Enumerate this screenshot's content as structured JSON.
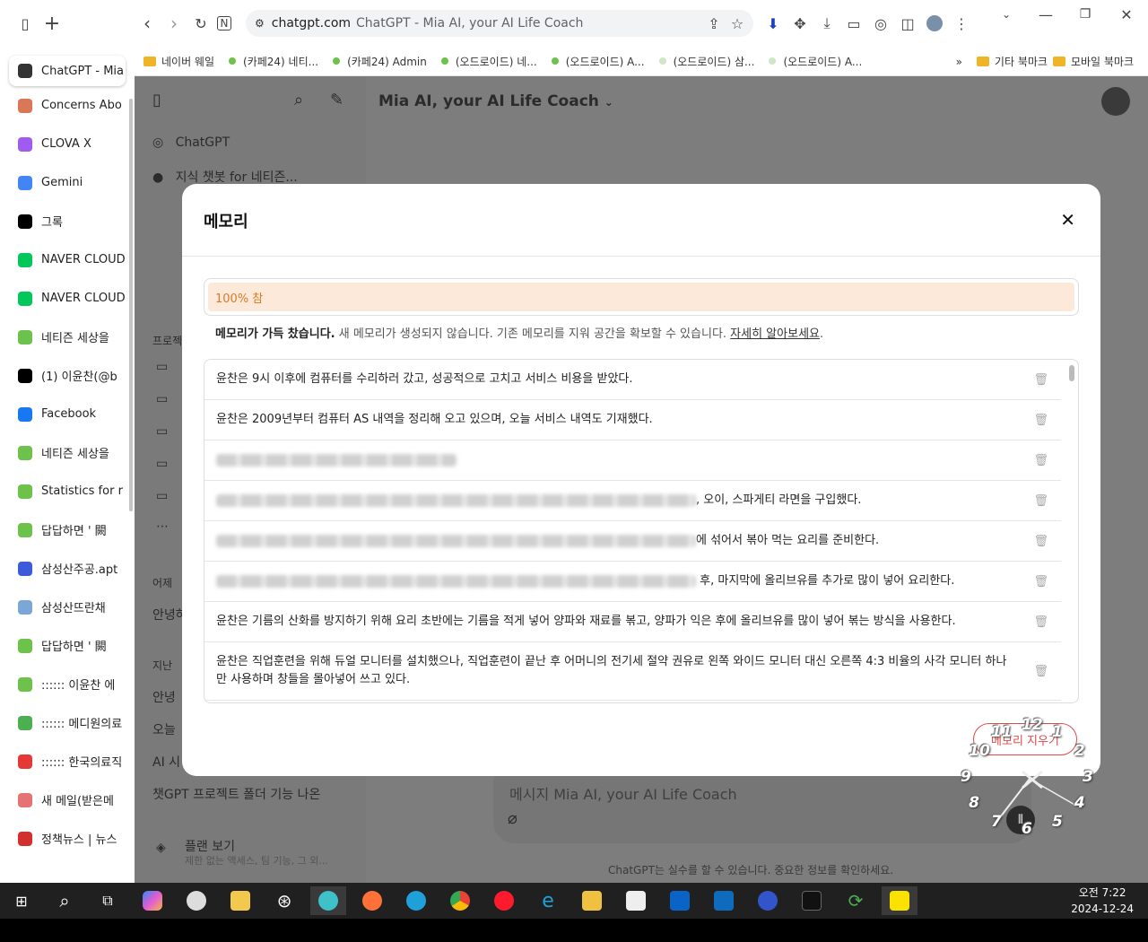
{
  "browser": {
    "url_domain": "chatgpt.com",
    "page_title": "ChatGPT - Mia AI, your AI Life Coach",
    "bookmarks": [
      "네이버 웨일",
      "(카페24) 네티...",
      "(카페24) Admin",
      "(오드로이드) 네...",
      "(오드로이드) A...",
      "(오드로이드) 삼...",
      "(오드로이드) A..."
    ],
    "bookmarks_overflow": "»",
    "bookmark_folders": [
      "기타 북마크",
      "모바일 북마크"
    ]
  },
  "tabs": [
    {
      "label": "ChatGPT - Mia",
      "icon": "chatgpt-icon",
      "color": "#333333"
    },
    {
      "label": "Concerns Abo",
      "icon": "claude-icon",
      "color": "#d97757"
    },
    {
      "label": "CLOVA X",
      "icon": "clova-icon",
      "color": "#a05cf0"
    },
    {
      "label": "Gemini",
      "icon": "gemini-icon",
      "color": "#4285f4"
    },
    {
      "label": "그록",
      "icon": "x-icon",
      "color": "#000000"
    },
    {
      "label": "NAVER CLOUD",
      "icon": "naver-cloud-icon",
      "color": "#03c75a"
    },
    {
      "label": "NAVER CLOUD",
      "icon": "naver-cloud-icon",
      "color": "#03c75a"
    },
    {
      "label": "네티즌 세상을",
      "icon": "y-icon",
      "color": "#6cc24a"
    },
    {
      "label": "(1) 이윤찬(@b",
      "icon": "x-icon",
      "color": "#000000"
    },
    {
      "label": "Facebook",
      "icon": "facebook-icon",
      "color": "#1877f2"
    },
    {
      "label": "네티즌 세상을",
      "icon": "y-icon",
      "color": "#6cc24a"
    },
    {
      "label": "Statistics for r",
      "icon": "y-icon",
      "color": "#6cc24a"
    },
    {
      "label": "답답하면 ' 闕",
      "icon": "y-icon",
      "color": "#6cc24a"
    },
    {
      "label": "삼성산주공.apt",
      "icon": "app-icon",
      "color": "#3b5bdb"
    },
    {
      "label": "삼성산뜨란채",
      "icon": "app-icon",
      "color": "#7aa6d8"
    },
    {
      "label": "답답하면 ' 闕",
      "icon": "y-icon",
      "color": "#6cc24a"
    },
    {
      "label": ":::::: 이윤찬 에",
      "icon": "y-icon",
      "color": "#6cc24a"
    },
    {
      "label": ":::::: 메디원의료",
      "icon": "medi-icon",
      "color": "#4caf50"
    },
    {
      "label": ":::::: 한국의료직",
      "icon": "medi-icon",
      "color": "#e53935"
    },
    {
      "label": "새 메일(받은메",
      "icon": "mail-icon",
      "color": "#e57373"
    },
    {
      "label": "정책뉴스 | 뉴스",
      "icon": "news-icon",
      "color": "#d32f2f"
    }
  ],
  "app": {
    "title": "Mia AI, your AI Life Coach",
    "sidebar": {
      "top": [
        {
          "label": "ChatGPT",
          "icon": "chatgpt-icon"
        },
        {
          "label": "지식 챗봇 for 네티즌...",
          "icon": "gpt-avatar-icon"
        }
      ],
      "sections": [
        "프로젝",
        "어제",
        "안녕하",
        "지난",
        "안녕",
        "오늘",
        "AI 시"
      ],
      "recent": "챗GPT 프로젝트 폴더 기능 나온",
      "upgrade_title": "플랜 보기",
      "upgrade_sub": "제한 없는 액세스, 팀 기능, 그 외..."
    },
    "composer_placeholder": "메시지 Mia AI, your AI Life Coach",
    "disclaimer": "ChatGPT는 실수를 할 수 있습니다. 중요한 정보를 확인하세요."
  },
  "modal": {
    "title": "메모리",
    "progress_label": "100% 참",
    "progress_value": 1.0,
    "notice_bold": "메모리가 가득 찼습니다.",
    "notice_text": " 새 메모리가 생성되지 않습니다. 기존 메모리를 지워 공간을 확보할 수 있습니다. ",
    "notice_link": "자세히 알아보세요",
    "notice_end": ".",
    "items": [
      "윤찬은 9시 이후에 컴퓨터를 수리하러 갔고, 성공적으로 고치고 서비스 비용을 받았다.",
      "윤찬은 2009년부터 컴퓨터 AS 내역을 정리해 오고 있으며, 오늘 서비스 내역도 기재했다.",
      "",
      ", 오이, 스파게티 라면을 구입했다.",
      "에 섞어서 볶아 먹는 요리를 준비한다.",
      " 후, 마지막에 올리브유를 추가로 많이 넣어 요리한다.",
      "윤찬은 기름의 산화를 방지하기 위해 요리 초반에는 기름을 적게 넣어 양파와 재료를 볶고, 양파가 익은 후에 올리브유를 많이 넣어 볶는 방식을 사용한다.",
      "윤찬은 직업훈련을 위해 듀얼 모니터를 설치했으나, 직업훈련이 끝난 후 어머니의 전기세 절약 권유로 왼쪽 와이드 모니터 대신 오른쪽 4:3 비율의 사각 모니터 하나만 사용하며 창들을 몰아넣어 쓰고 있다."
    ],
    "clear_button": "메모리 지우기"
  },
  "clock_numbers": [
    "12",
    "1",
    "2",
    "3",
    "4",
    "5",
    "6",
    "7",
    "8",
    "9",
    "10",
    "11"
  ],
  "taskbar": {
    "time": "오전 7:22",
    "date": "2024-12-24"
  }
}
